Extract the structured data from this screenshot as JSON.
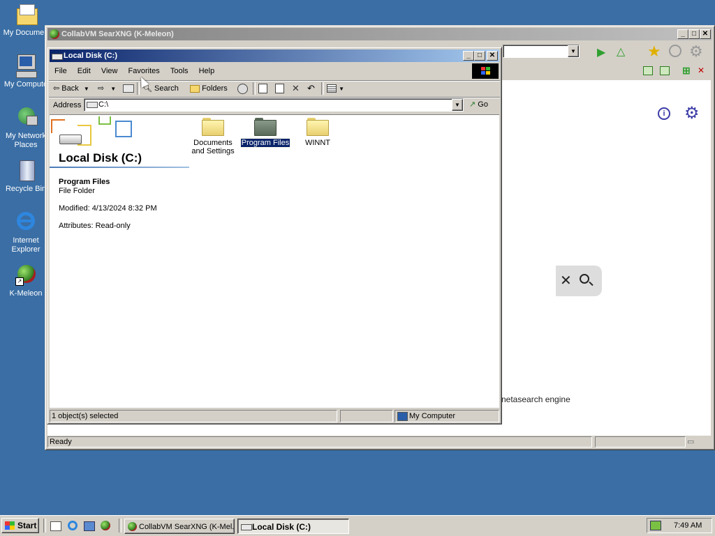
{
  "desktop": {
    "icons": [
      {
        "label": "My Documents",
        "label_display": "My Documen",
        "icon": "folder-documents-icon"
      },
      {
        "label": "My Computer",
        "label_display": "My Compute",
        "icon": "computer-icon"
      },
      {
        "label_line1": "My Network",
        "label_line2": "Places",
        "icon": "network-icon"
      },
      {
        "label": "Recycle Bin",
        "icon": "recycle-bin-icon"
      },
      {
        "label_line1": "Internet",
        "label_line2": "Explorer",
        "icon": "ie-icon"
      },
      {
        "label": "K-Meleon",
        "icon": "kmeleon-icon"
      }
    ]
  },
  "browser": {
    "title": "CollabVM SearXNG (K-Meleon)",
    "status": "Ready",
    "tagline": "netasearch engine",
    "colors": {
      "accent": "#3c3ca8"
    }
  },
  "explorer": {
    "title": "Local Disk (C:)",
    "menu": [
      "File",
      "Edit",
      "View",
      "Favorites",
      "Tools",
      "Help"
    ],
    "toolbar": {
      "back": "Back",
      "search": "Search",
      "folders": "Folders"
    },
    "address_label": "Address",
    "address_value": "C:\\",
    "go_label": "Go",
    "panel": {
      "heading": "Local Disk (C:)",
      "item_name": "Program Files",
      "item_type": "File Folder",
      "modified": "Modified: 4/13/2024 8:32 PM",
      "attributes": "Attributes: Read-only"
    },
    "folders": [
      {
        "line1": "Documents",
        "line2": "and Settings",
        "selected": false
      },
      {
        "line1": "Program Files",
        "selected": true
      },
      {
        "line1": "WINNT",
        "selected": false
      }
    ],
    "status_left": "1 object(s) selected",
    "status_right": "My Computer"
  },
  "taskbar": {
    "start": "Start",
    "tasks": [
      "CollabVM SearXNG (K-Mel...",
      "Local Disk (C:)"
    ],
    "clock": "7:49 AM"
  }
}
